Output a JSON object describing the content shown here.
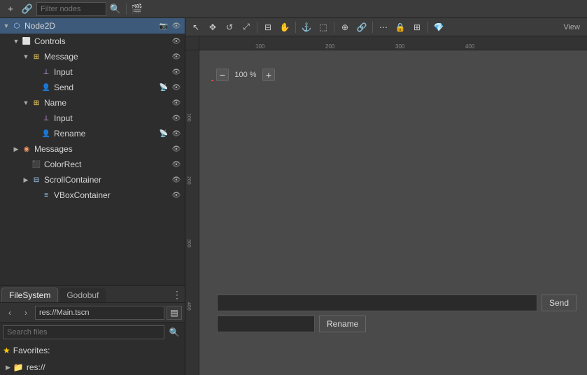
{
  "toolbar": {
    "add_label": "+",
    "link_label": "🔗",
    "filter_placeholder": "Filter nodes",
    "search_icon": "🔍",
    "scene_icon": "🎬"
  },
  "scene_tree": {
    "items": [
      {
        "id": "node2d",
        "label": "Node2D",
        "depth": 0,
        "icon": "⬡",
        "icon_class": "icon-node2d",
        "has_arrow": true,
        "arrow_open": true,
        "actions": [
          "📷",
          "👁"
        ]
      },
      {
        "id": "controls",
        "label": "Controls",
        "depth": 1,
        "icon": "⬜",
        "icon_class": "icon-control",
        "has_arrow": true,
        "arrow_open": true,
        "actions": [
          "👁"
        ]
      },
      {
        "id": "message",
        "label": "Message",
        "depth": 2,
        "icon": "⊞",
        "icon_class": "icon-message",
        "has_arrow": true,
        "arrow_open": true,
        "actions": [
          "👁"
        ]
      },
      {
        "id": "input1",
        "label": "Input",
        "depth": 3,
        "icon": "⊥",
        "icon_class": "icon-input",
        "has_arrow": false,
        "actions": [
          "👁"
        ]
      },
      {
        "id": "send",
        "label": "Send",
        "depth": 3,
        "icon": "👤",
        "icon_class": "icon-send",
        "has_arrow": false,
        "actions": [
          "📡",
          "👁"
        ]
      },
      {
        "id": "name",
        "label": "Name",
        "depth": 2,
        "icon": "⊞",
        "icon_class": "icon-name-node",
        "has_arrow": true,
        "arrow_open": true,
        "actions": [
          "👁"
        ]
      },
      {
        "id": "input2",
        "label": "Input",
        "depth": 3,
        "icon": "⊥",
        "icon_class": "icon-input",
        "has_arrow": false,
        "actions": [
          "👁"
        ]
      },
      {
        "id": "rename",
        "label": "Rename",
        "depth": 3,
        "icon": "👤",
        "icon_class": "icon-rename",
        "has_arrow": false,
        "actions": [
          "📡",
          "👁"
        ]
      },
      {
        "id": "messages",
        "label": "Messages",
        "depth": 1,
        "icon": "◉",
        "icon_class": "icon-messages",
        "has_arrow": true,
        "arrow_open": false,
        "actions": [
          "👁"
        ]
      },
      {
        "id": "colorrect",
        "label": "ColorRect",
        "depth": 2,
        "icon": "⬛",
        "icon_class": "icon-colorrect",
        "has_arrow": false,
        "actions": [
          "👁"
        ]
      },
      {
        "id": "scrollcontainer",
        "label": "ScrollContainer",
        "depth": 2,
        "icon": "⊟",
        "icon_class": "icon-scroll",
        "has_arrow": true,
        "arrow_open": false,
        "actions": [
          "👁"
        ]
      },
      {
        "id": "vboxcontainer",
        "label": "VBoxContainer",
        "depth": 3,
        "icon": "≡",
        "icon_class": "icon-vbox",
        "has_arrow": false,
        "actions": [
          "👁"
        ]
      }
    ]
  },
  "bottom_panel": {
    "tabs": [
      {
        "id": "filesystem",
        "label": "FileSystem",
        "active": true
      },
      {
        "id": "godobuf",
        "label": "Godobuf",
        "active": false
      }
    ],
    "more_label": "⋮",
    "nav": {
      "back_label": "‹",
      "forward_label": "›",
      "path": "res://Main.tscn",
      "folder_label": "▤"
    },
    "search": {
      "placeholder": "Search files",
      "search_icon": "🔍"
    },
    "favorites": {
      "star": "★",
      "label": "Favorites:",
      "arrow": "▼"
    },
    "res": {
      "label": "res://",
      "arrow": "▶",
      "icon": "📁"
    }
  },
  "viewport": {
    "toolbar_buttons": [
      "↖",
      "✥",
      "↺",
      "⤢",
      "⊟",
      "✋",
      "⬚",
      "⚓",
      "🔗",
      "⋯",
      "🔒",
      "⊕",
      "⊞",
      "💎",
      "View"
    ],
    "zoom_label": "100 %",
    "zoom_minus": "−",
    "zoom_plus": "+",
    "ruler_h_ticks": [
      "100",
      "200",
      "300",
      "400"
    ],
    "ruler_v_ticks": [
      "100",
      "200",
      "300",
      "400"
    ],
    "widget_send_label": "Send",
    "widget_rename_label": "Rename"
  },
  "colors": {
    "accent_blue": "#3d5a7a",
    "bg_dark": "#2b2b2b",
    "bg_panel": "#2d2d2d",
    "bg_toolbar": "#3c3c3c"
  }
}
